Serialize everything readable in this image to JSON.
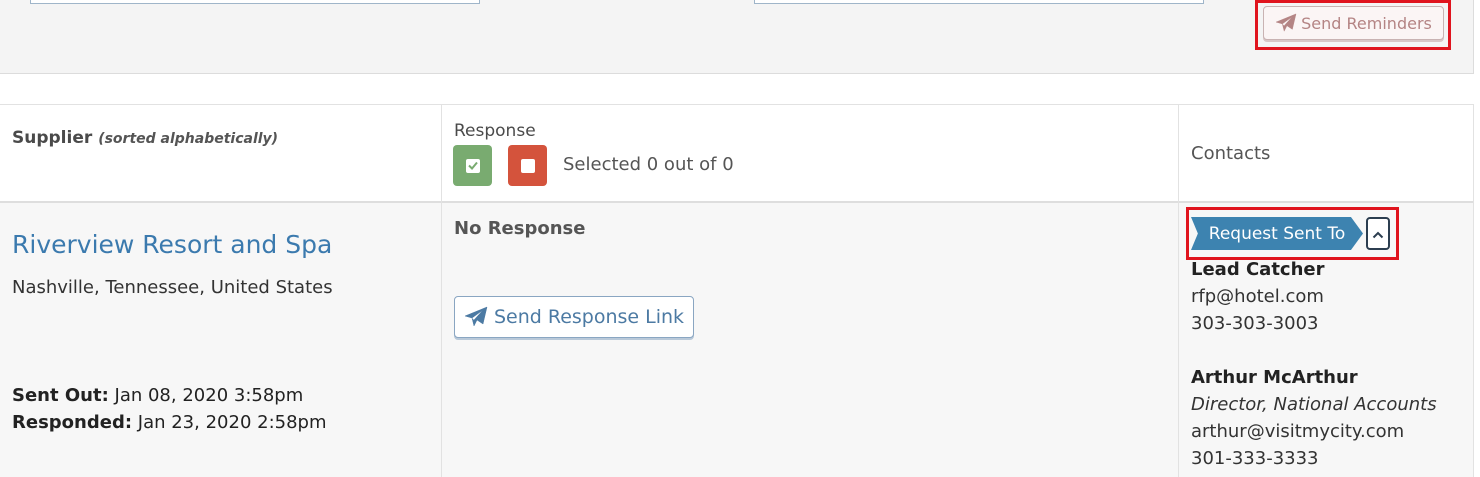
{
  "toolbar": {
    "send_reminders_label": "Send Reminders",
    "send_reminders_icon": "paper-plane-icon"
  },
  "table": {
    "headers": {
      "supplier": "Supplier",
      "supplier_note": "(sorted alphabetically)",
      "response": "Response",
      "selected_count": "Selected 0 out of 0",
      "contacts": "Contacts"
    },
    "rows": [
      {
        "supplier_name": "Riverview Resort and Spa",
        "location": "Nashville, Tennessee, United States",
        "sent_out_label": "Sent Out:",
        "sent_out_value": "Jan 08, 2020 3:58pm",
        "responded_label": "Responded:",
        "responded_value": "Jan 23, 2020 2:58pm",
        "response_status": "No Response",
        "send_response_link_label": "Send Response Link",
        "request_tag": "Request Sent To",
        "contacts": [
          {
            "name": "Lead Catcher",
            "title": "",
            "email": "rfp@hotel.com",
            "phone": "303-303-3003"
          },
          {
            "name": "Arthur McArthur",
            "title": "Director, National Accounts",
            "email": "arthur@visitmycity.com",
            "phone": "301-333-3333"
          }
        ]
      }
    ]
  },
  "colors": {
    "link": "#3b7aae",
    "accept": "#79ab70",
    "decline": "#d4533c",
    "tag": "#3d83b0",
    "highlight": "#e0141e"
  }
}
